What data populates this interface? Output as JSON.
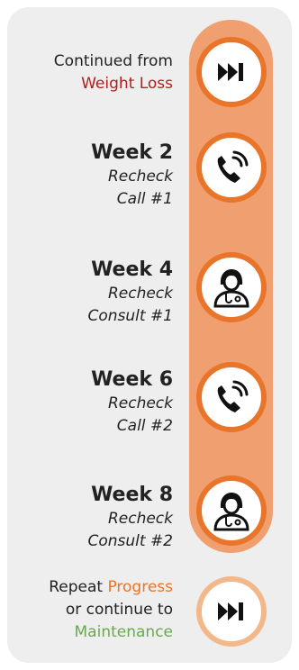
{
  "header": {
    "line1": "Continued from",
    "line2": "Weight Loss"
  },
  "steps": [
    {
      "week": "Week 2",
      "type": "Recheck",
      "detail": "Call #1",
      "icon": "phone-icon"
    },
    {
      "week": "Week 4",
      "type": "Recheck",
      "detail": "Consult #1",
      "icon": "doctor-icon"
    },
    {
      "week": "Week 6",
      "type": "Recheck",
      "detail": "Call #2",
      "icon": "phone-icon"
    },
    {
      "week": "Week 8",
      "type": "Recheck",
      "detail": "Consult #2",
      "icon": "doctor-icon"
    }
  ],
  "footer": {
    "line1_prefix": "Repeat",
    "line1_highlight": "Progress",
    "line2": "or continue to",
    "line3": "Maintenance"
  },
  "colors": {
    "accent": "#e8752a",
    "rail": "#f0a070",
    "weight_loss": "#b51c1c",
    "progress": "#e8752a",
    "maintenance": "#6aa84f",
    "card_bg": "#eeeeee"
  }
}
